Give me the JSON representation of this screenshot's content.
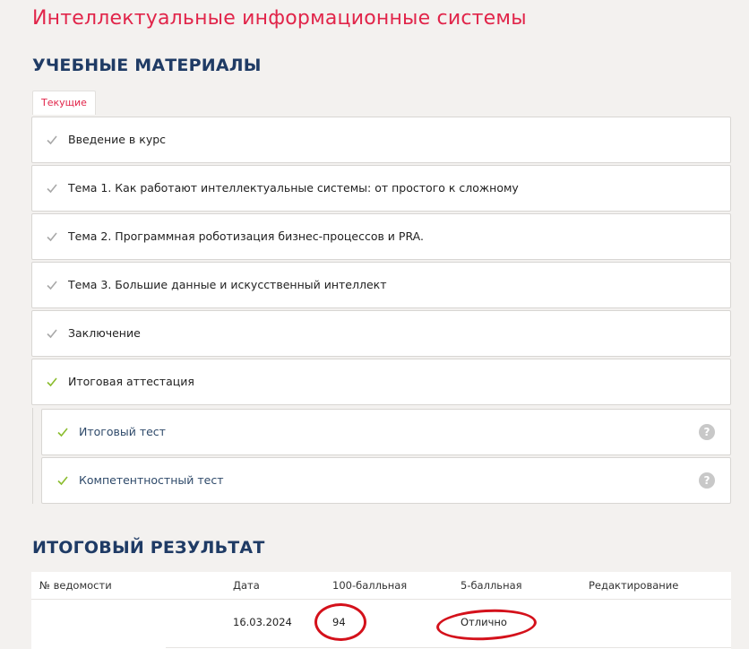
{
  "page_title": "Интеллектуальные информационные системы",
  "materials_title": "УЧЕБНЫЕ МАТЕРИАЛЫ",
  "tab_current": "Текущие",
  "items": [
    {
      "label": "Введение в курс"
    },
    {
      "label": "Тема 1. Как работают интеллектуальные системы: от простого к сложному"
    },
    {
      "label": "Тема 2. Программная роботизация бизнес-процессов и PRA."
    },
    {
      "label": "Тема 3. Большие данные и искусственный интеллект"
    },
    {
      "label": "Заключение"
    },
    {
      "label": "Итоговая аттестация"
    }
  ],
  "subitems": [
    {
      "label": "Итоговый тест",
      "help": "?"
    },
    {
      "label": "Компетентностный тест",
      "help": "?"
    }
  ],
  "results_title": "ИТОГОВЫЙ РЕЗУЛЬТАТ",
  "results_table": {
    "headers": [
      "№ ведомости",
      "Дата",
      "100-балльная",
      "5-балльная",
      "Редактирование"
    ],
    "rows": [
      {
        "statement": "",
        "date": "16.03.2024",
        "score100": "94",
        "score5": "Отлично",
        "edit": ""
      }
    ]
  },
  "colors": {
    "accent": "#e1254a",
    "heading": "#1f3b65",
    "check_gray": "#a9a9a9",
    "check_green": "#8bbd2f",
    "annotation": "#d4111b"
  },
  "icons": {
    "item_check": "check-icon",
    "help": "question-circle-icon"
  }
}
